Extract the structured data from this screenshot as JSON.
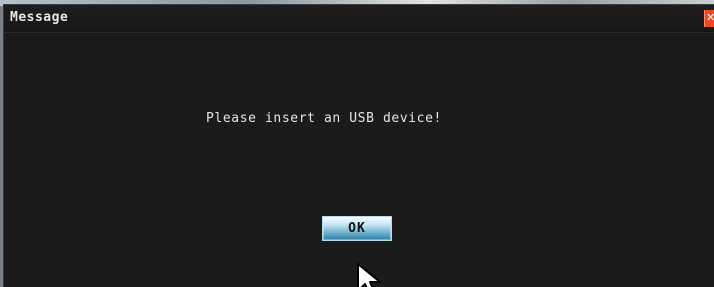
{
  "window": {
    "title": "Message",
    "close_icon": "✕"
  },
  "dialog": {
    "message": "Please insert an USB device!",
    "ok_label": "OK"
  },
  "icons": {
    "close": "close-icon",
    "cursor": "mouse-pointer-icon"
  },
  "colors": {
    "background": "#1b1b1b",
    "text": "#e5e5e5",
    "close_button": "#e84a2a",
    "ok_button_top": "#f5fbff",
    "ok_button_bottom": "#2c7ea6"
  }
}
